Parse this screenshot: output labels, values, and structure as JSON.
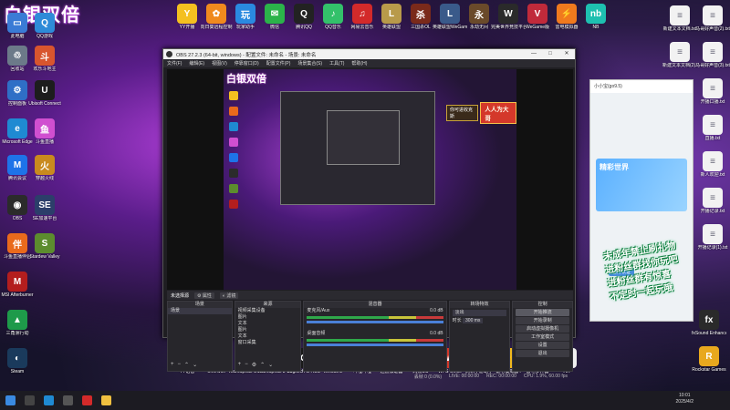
{
  "overlay_title": "白银双倍",
  "desktop_icons_left": [
    {
      "label": "此电脑",
      "color": "#3a7bd5",
      "glyph": "▭",
      "icon": "computer-icon"
    },
    {
      "label": "QQ游戏",
      "color": "#2e8bd8",
      "glyph": "Q",
      "icon": "qq-game-icon"
    },
    {
      "label": "回收站",
      "color": "#6c7a89",
      "glyph": "🗑",
      "icon": "recycle-bin-icon"
    },
    {
      "label": "欢乐斗地主",
      "color": "#d8552e",
      "glyph": "斗",
      "icon": "doudizhu-icon"
    },
    {
      "label": "控制面板",
      "color": "#2f6fc6",
      "glyph": "⚙",
      "icon": "control-panel-icon"
    },
    {
      "label": "Ubisoft Connect",
      "color": "#1d1d1d",
      "glyph": "U",
      "icon": "ubisoft-icon"
    },
    {
      "label": "Microsoft Edge",
      "color": "#1f8ad2",
      "glyph": "e",
      "icon": "edge-icon"
    },
    {
      "label": "斗鱼直播",
      "color": "#d04fd0",
      "glyph": "鱼",
      "icon": "douyu-icon"
    },
    {
      "label": "腾讯会议",
      "color": "#1e73e8",
      "glyph": "M",
      "icon": "tencent-meeting-icon"
    },
    {
      "label": "穿越火线",
      "color": "#c98a1e",
      "glyph": "火",
      "icon": "crossfire-icon"
    },
    {
      "label": "OBS",
      "color": "#2b2b2b",
      "glyph": "◉",
      "icon": "obs-icon"
    },
    {
      "label": "SE加速平台",
      "color": "#2c3e6a",
      "glyph": "SE",
      "icon": "se-accelerator-icon"
    },
    {
      "label": "斗鱼直播伴侣",
      "color": "#e96a1c",
      "glyph": "伴",
      "icon": "douyu-companion-icon"
    },
    {
      "label": "Stardew Valley",
      "color": "#5c8c2e",
      "glyph": "S",
      "icon": "stardew-icon"
    },
    {
      "label": "MSI Afterburner",
      "color": "#b31e1e",
      "glyph": "M",
      "icon": "afterburner-icon"
    },
    {
      "label": "三角洲行动",
      "color": "#1e9a4a",
      "glyph": "▲",
      "icon": "delta-force-icon"
    },
    {
      "label": "Steam",
      "color": "#1a3a5c",
      "glyph": "◐",
      "icon": "steam-icon"
    }
  ],
  "desktop_icons_top": [
    {
      "label": "YY开播",
      "color": "#f4c020",
      "glyph": "Y",
      "icon": "yy-live-icon"
    },
    {
      "label": "向日葵远程控制",
      "color": "#f08a1e",
      "glyph": "✿",
      "icon": "sunflower-icon"
    },
    {
      "label": "玩家助手",
      "color": "#2a8ae0",
      "glyph": "玩",
      "icon": "player-helper-icon"
    },
    {
      "label": "微信",
      "color": "#2bb34a",
      "glyph": "✉",
      "icon": "wechat-icon"
    },
    {
      "label": "腾讯QQ",
      "color": "#222",
      "glyph": "Q",
      "icon": "qq-icon"
    },
    {
      "label": "QQ音乐",
      "color": "#33c16a",
      "glyph": "♪",
      "icon": "qq-music-icon"
    },
    {
      "label": "网易云音乐",
      "color": "#d32a2a",
      "glyph": "♫",
      "icon": "netease-music-icon"
    },
    {
      "label": "英雄联盟",
      "color": "#b89a4a",
      "glyph": "L",
      "icon": "lol-icon"
    },
    {
      "label": "三国杀OL",
      "color": "#7a2a1a",
      "glyph": "杀",
      "icon": "sanguosha-icon"
    },
    {
      "label": "英雄联盟WeGame版",
      "color": "#3a5a8a",
      "glyph": "L",
      "icon": "lol-wegame-icon"
    },
    {
      "label": "永劫无间",
      "color": "#6a4a2a",
      "glyph": "永",
      "icon": "naraka-icon"
    },
    {
      "label": "完美世界竞技平台",
      "color": "#2a2a2a",
      "glyph": "W",
      "icon": "perfect-world-icon"
    },
    {
      "label": "WeGame版",
      "color": "#c02a3a",
      "glyph": "V",
      "icon": "valorant-wegame-icon"
    },
    {
      "label": "雷电模拟器",
      "color": "#f07a1e",
      "glyph": "⚡",
      "icon": "ldplayer-icon"
    },
    {
      "label": "NB",
      "color": "#1ec0b0",
      "glyph": "nb",
      "icon": "nb-icon"
    }
  ],
  "desktop_files_right": [
    {
      "label": "新建文本文档.txt",
      "icon": "text-file-icon"
    },
    {
      "label": "马哥好声音(2).txt",
      "icon": "text-file-icon"
    },
    {
      "label": "新建文本文档(2).txt",
      "icon": "text-file-icon"
    },
    {
      "label": "马哥好声音(3).txt",
      "icon": "text-file-icon"
    },
    {
      "label": "开播口播.txt",
      "icon": "text-file-icon"
    },
    {
      "label": "开播记录2.txt",
      "icon": "text-file-icon"
    },
    {
      "label": "马哥好声音(2).txt",
      "icon": "text-file-icon"
    },
    {
      "label": "直播.txt",
      "icon": "text-file-icon"
    },
    {
      "label": "新建文本文档.txt",
      "icon": "text-file-icon"
    },
    {
      "label": "新人欢迎.txt",
      "icon": "text-file-icon"
    },
    {
      "label": "马哥好声音(1).txt",
      "icon": "text-file-icon"
    },
    {
      "label": "开播记录.txt",
      "icon": "text-file-icon"
    },
    {
      "label": "开播记录(1).txt",
      "icon": "text-file-icon"
    },
    {
      "label": "马哥好声音(2).txt",
      "icon": "text-file-icon"
    }
  ],
  "desktop_icons_right_bottom": [
    {
      "label": "fxSound Enhancer",
      "color": "#2a2a2a",
      "glyph": "fx",
      "icon": "fxsound-icon"
    },
    {
      "label": "Rockstar Games",
      "color": "#e8a81e",
      "glyph": "R",
      "icon": "rockstar-icon"
    }
  ],
  "desktop_icons_bottom": [
    {
      "label": "YY语音",
      "color": "#f4c020",
      "glyph": "Y",
      "icon": "yy-voice-icon"
    },
    {
      "label": "Overwolf",
      "color": "#2a2a2a",
      "glyph": "W",
      "icon": "overwolf-icon"
    },
    {
      "label": "TeamSpeak Overlay",
      "color": "#1c2a3a",
      "glyph": "TS",
      "icon": "teamspeak-overlay-icon"
    },
    {
      "label": "TeamSpeak 3 Client",
      "color": "#2a6ab0",
      "glyph": "TS",
      "icon": "teamspeak-icon"
    },
    {
      "label": "Logitech G HUB",
      "color": "#1a1a1a",
      "glyph": "G",
      "icon": "ghub-icon"
    },
    {
      "label": "WeGame",
      "color": "#d4382a",
      "glyph": "G",
      "icon": "wegame-icon"
    },
    {
      "label": "哔哩哔哩",
      "color": "#e8e8e8",
      "glyph": "B",
      "icon": "bilibili-icon"
    },
    {
      "label": "迅游加速器",
      "color": "#2a7ae0",
      "glyph": "A",
      "icon": "xunyou-icon"
    },
    {
      "label": "网易UU",
      "color": "#1a1a1a",
      "glyph": "U",
      "icon": "uu-icon"
    },
    {
      "label": "WPS Office",
      "color": "#d4382a",
      "glyph": "W",
      "icon": "wps-icon"
    },
    {
      "label": "腾讯手游助手",
      "color": "#d04a3a",
      "glyph": "手",
      "icon": "tencent-mobile-icon"
    },
    {
      "label": "雷电模拟器4",
      "color": "#f0b81e",
      "glyph": "⚡",
      "icon": "ldplayer4-icon"
    },
    {
      "label": "雷电多开器",
      "color": "#f0b81e",
      "glyph": "多",
      "icon": "ld-multi-icon"
    },
    {
      "label": "HR",
      "color": "#f0f0f0",
      "glyph": "H",
      "icon": "hr-file-icon"
    }
  ],
  "obs": {
    "title": "OBS 27.2.3 (64-bit, windows) - 配置文件: 未命名 - 场景: 未命名",
    "menu": [
      "文件(F)",
      "编辑(E)",
      "视图(V)",
      "停靠窗口(D)",
      "配置文件(P)",
      "场景集合(S)",
      "工具(T)",
      "帮助(H)"
    ],
    "canvas_overlay": "白银双倍",
    "banner_small": "你可进收克斯",
    "banner_big": "人人为大哥",
    "source_label": "未选择源",
    "props_btn": "属性",
    "filters_btn": "滤镜",
    "docks": {
      "scenes": "场景",
      "sources": "来源",
      "mixer": "混音器",
      "transitions": "转场特效",
      "controls": "控制"
    },
    "scene_items": [
      "场景"
    ],
    "source_items": [
      "视频采集设备",
      "图片",
      "文本",
      "图片",
      "文本",
      "窗口采集"
    ],
    "mixer_tracks": [
      {
        "name": "麦克风/Aux",
        "db": "0.0 dB"
      },
      {
        "name": "桌面音频",
        "db": "0.0 dB"
      }
    ],
    "transition": {
      "value": "淡出",
      "duration_label": "时长",
      "duration": "300 ms"
    },
    "controls": [
      "开始推流",
      "开始录制",
      "启动虚拟摄像机",
      "工作室模式",
      "设置",
      "退出"
    ],
    "status": {
      "live": "LIVE: 00:00:00",
      "rec": "REC: 00:00:00",
      "cpu": "CPU: 1.9%, 60.00 fps",
      "frames": "丢帧 0 (0.0%)"
    }
  },
  "chat_panel": {
    "header": "小小宝(go9.5)",
    "card_title": "精彩世界",
    "notice": "官方认证"
  },
  "promo_text": [
    "未成年禁止刷礼物",
    "进粉丝群找你玩吧",
    "进粉丝群有惊喜",
    "不定时一起玩哦"
  ],
  "clock": {
    "time": "10:01",
    "date": "2025/4/2"
  }
}
